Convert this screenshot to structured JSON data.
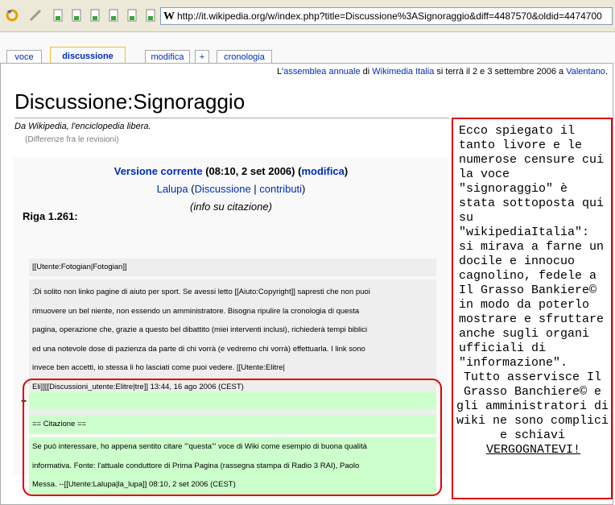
{
  "browser": {
    "url": "http://it.wikipedia.org/w/index.php?title=Discussione%3ASignoraggio&diff=4487570&oldid=4474700",
    "site_logo_letter": "W",
    "toolbar_icons": [
      "reload-icon",
      "edit-pencil-icon",
      "page-icon",
      "page-icon",
      "page-icon",
      "page-icon",
      "page-icon",
      "page-icon",
      "page-icon"
    ]
  },
  "tabs": [
    {
      "label": "voce",
      "selected": false
    },
    {
      "label": "discussione",
      "selected": true
    },
    {
      "label": "modifica",
      "selected": false
    },
    {
      "label": "+",
      "selected": false
    },
    {
      "label": "cronologia",
      "selected": false
    }
  ],
  "sitenotice": {
    "p1": "L'",
    "link1": "assemblea annuale",
    "p2": " di ",
    "link2": "Wikimedia Italia",
    "p3": " si terrà il 2 e 3 settembre 2006 a ",
    "link3": "Valentano",
    "p4": "."
  },
  "page": {
    "title": "Discussione:Signoraggio",
    "site_sub": "Da Wikipedia, l'enciclopedia libera.",
    "content_sub": "(Differenze fra le revisioni)"
  },
  "diff": {
    "version_link": "Versione corrente",
    "version_time": " (08:10, 2 set 2006) (",
    "edit_link": "modifica",
    "version_close": ")",
    "user_link": "Lalupa",
    "user_sep1": " (",
    "talk_link": "Discussione",
    "user_sep2": " | ",
    "contribs_link": "contributi",
    "user_sep3": ")",
    "summary": "(info su citazione)",
    "line_label": "Riga 1.261:",
    "context_line": "[[Utente:Fotogian|Fotogian]]",
    "deleted_lines": [
      ":Di solito non linko pagine di aiuto per sport. Se avessi letto [[Aiuto:Copyright]] sapresti che non puoi",
      "rimuovere un bel niente, non essendo un amministratore. Bisogna ripulire la cronologia di questa",
      "pagina, operazione che, grazie a questo bel dibattito (miei interventi inclusi), richiederà tempi biblici",
      "ed una notevole dose di pazienza da parte di chi vorrà (e vedremo chi vorrà) effettuarla. I link sono",
      "invece ben accetti, io stessa li ho lasciati come puoi vedere. [[Utente:Elitre|",
      "Eli]][[Discussioni_utente:Elitre|tre]] 13:44, 16 ago 2006 (CEST)"
    ],
    "added_marker": "+",
    "added_heading": "== Citazione ==",
    "added_lines": [
      "Se può interessare, ho appena sentito citare '''questa''' voce di Wiki come esempio di buona qualità",
      "informativa. Fonte: l'attuale conduttore di Prima Pagina (rassegna stampa di Radio 3 RAI), Paolo",
      "Messa. --[[Utente:Lalupa|la_lupa]] 08:10, 2 set 2006 (CEST)"
    ]
  },
  "annotation": {
    "main": "Ecco spiegato il tanto livore e le numerose censure cui la voce \"signoraggio\" è stata sottoposta qui su \"wikipediaItalia\": si mirava a farne un docile e innocuo cagnolino, fedele a Il Grasso Bankiere© in modo da poterlo mostrare e sfruttare anche sugli organi ufficiali di \"informazione\".",
    "tail": "Tutto asservisce Il Grasso Banchiere© e gli amministratori di wiki ne sono complici e schiavi",
    "shout": "VERGOGNATEVI!"
  },
  "colors": {
    "annotation_border": "#e00000",
    "link": "#002bb8",
    "added_bg": "#ccffcc",
    "deleted_bg": "#eeeeee"
  }
}
